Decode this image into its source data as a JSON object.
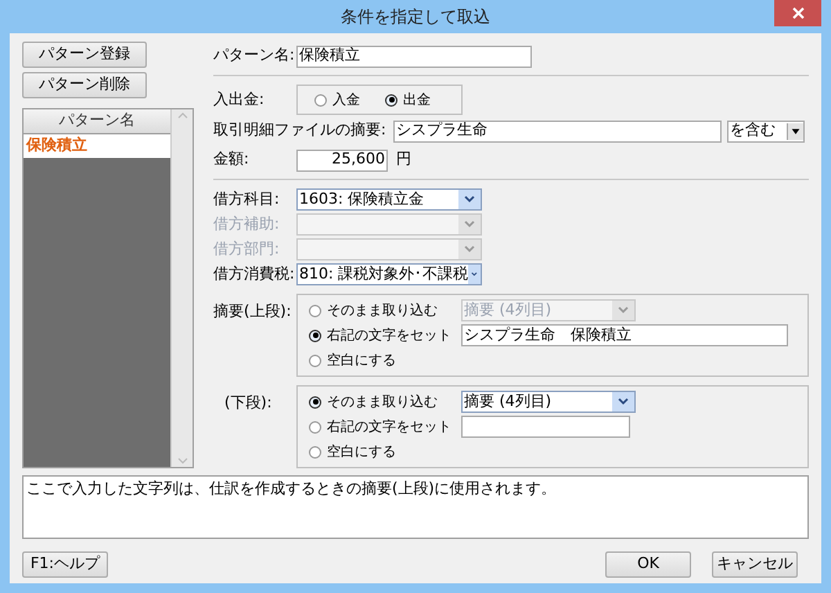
{
  "window": {
    "title": "条件を指定して取込"
  },
  "left": {
    "buttons": [
      "パターン登録",
      "パターン削除"
    ],
    "list": {
      "header": "パターン名",
      "items": [
        {
          "label": "保険積立",
          "selected": true
        }
      ]
    }
  },
  "form": {
    "pattern_name": {
      "label": "パターン名:",
      "value": "保険積立"
    },
    "in_out": {
      "label": "入出金:",
      "options": [
        {
          "label": "入金",
          "selected": false
        },
        {
          "label": "出金",
          "selected": true
        }
      ]
    },
    "summary_filter": {
      "label": "取引明細ファイルの摘要:",
      "value": "シスプラ生命",
      "condition": "を含む"
    },
    "amount": {
      "label": "金額:",
      "value": "25,600",
      "unit": "円"
    },
    "selects": [
      {
        "label": "借方科目:",
        "value": "1603: 保険積立金",
        "disabled": false
      },
      {
        "label": "借方補助:",
        "disabled": true
      },
      {
        "label": "借方部門:",
        "disabled": true
      },
      {
        "label": "借方消費税:",
        "value": "810: 課税対象外･不課税",
        "disabled": false
      }
    ],
    "memo_groups": [
      {
        "label": "摘要(上段):",
        "options": [
          {
            "kind": "select",
            "label": "そのまま取り込む",
            "selected": false,
            "value": "摘要 (4列目)"
          },
          {
            "kind": "text",
            "label": "右記の文字をセット",
            "selected": true,
            "value": "シスプラ生命　保険積立"
          },
          {
            "kind": "plain",
            "label": "空白にする",
            "selected": false
          }
        ]
      },
      {
        "label": "(下段):",
        "options": [
          {
            "kind": "select",
            "label": "そのまま取り込む",
            "selected": true,
            "value": "摘要 (4列目)"
          },
          {
            "kind": "text",
            "label": "右記の文字をセット",
            "selected": false
          },
          {
            "kind": "plain",
            "label": "空白にする",
            "selected": false
          }
        ]
      }
    ]
  },
  "description": "ここで入力した文字列は、仕訳を作成するときの摘要(上段)に使用されます。",
  "footer": {
    "help": "F1:ヘルプ",
    "ok": "OK",
    "cancel": "キャンセル"
  }
}
